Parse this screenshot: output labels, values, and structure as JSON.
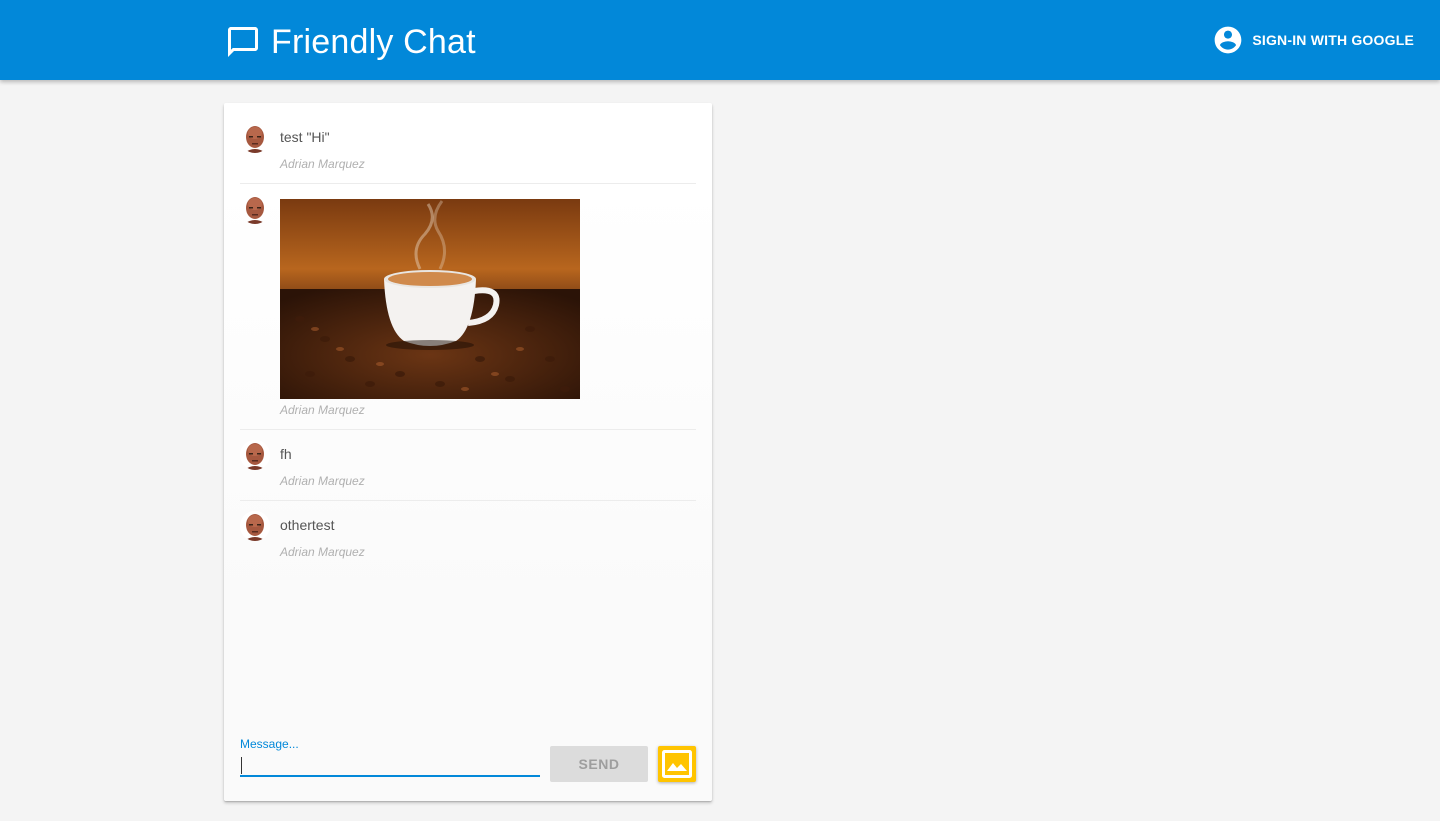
{
  "header": {
    "title": "Friendly Chat",
    "signin_label": "SIGN-IN WITH GOOGLE",
    "brand_icon": "chat-bubble-icon",
    "account_icon": "account-circle-icon",
    "background_color": "#0288d9"
  },
  "messages": [
    {
      "text": "test \"Hi\"",
      "name": "Adrian Marquez",
      "type": "text"
    },
    {
      "text": "",
      "name": "Adrian Marquez",
      "type": "image",
      "image": "coffee-cup-photo"
    },
    {
      "text": "fh",
      "name": "Adrian Marquez",
      "type": "text"
    },
    {
      "text": "othertest",
      "name": "Adrian Marquez",
      "type": "text"
    }
  ],
  "form": {
    "message_label": "Message...",
    "message_value": "",
    "send_label": "SEND",
    "image_button_icon": "image-icon",
    "image_button_color": "#ffc400"
  }
}
